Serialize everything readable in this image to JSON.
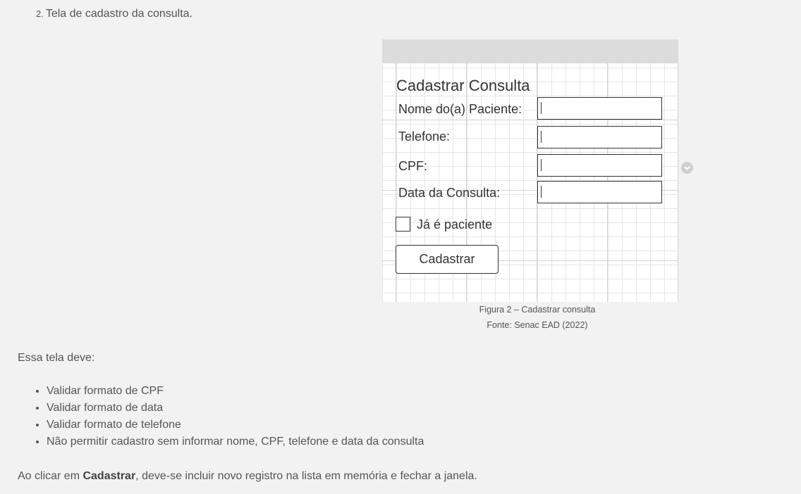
{
  "step": {
    "number": "2.",
    "text": "Tela de cadastro da consulta."
  },
  "figure": {
    "form_title": "Cadastrar Consulta",
    "fields": [
      {
        "label": "Nome do(a) Paciente:",
        "value": ""
      },
      {
        "label": "Telefone:",
        "value": ""
      },
      {
        "label": "CPF:",
        "value": ""
      },
      {
        "label": "Data da Consulta:",
        "value": ""
      }
    ],
    "checkbox_label": "Já é paciente",
    "button_label": "Cadastrar"
  },
  "caption": {
    "title": "Figura 2 – Cadastrar consulta",
    "source": "Fonte: Senac EAD (2022)"
  },
  "intro": "Essa tela deve:",
  "requirements": [
    "Validar formato de CPF",
    "Validar formato de data",
    "Validar formato de telefone",
    "Não permitir cadastro sem informar nome, CPF, telefone e data da consulta"
  ],
  "closing": {
    "before": "Ao clicar em ",
    "bold": "Cadastrar",
    "after": ", deve-se incluir novo registro na lista em memória e fechar a janela."
  },
  "icons": {
    "side": "chevron-down-circle-icon"
  }
}
